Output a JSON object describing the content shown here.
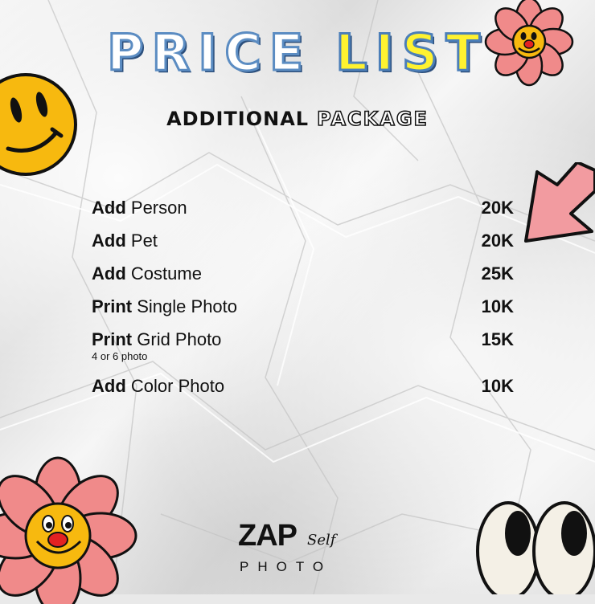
{
  "title": {
    "word1": "PRICE",
    "word2": "LIST"
  },
  "subtitle": {
    "part1": "ADDITIONAL",
    "part2": "PACKAGE"
  },
  "items": [
    {
      "bold": "Add",
      "rest": "Person",
      "price": "20K"
    },
    {
      "bold": "Add",
      "rest": "Pet",
      "price": "20K"
    },
    {
      "bold": "Add",
      "rest": "Costume",
      "price": "25K"
    },
    {
      "bold": "Print",
      "rest": "Single Photo",
      "price": "10K"
    },
    {
      "bold": "Print",
      "rest": "Grid Photo",
      "price": "15K",
      "note": "4 or 6 photo"
    },
    {
      "bold": "Add",
      "rest": "Color Photo",
      "price": "10K"
    }
  ],
  "logo": {
    "main": "ZAP",
    "script": "Self",
    "sub": "PHOTO"
  },
  "colors": {
    "title_white": "#ffffff",
    "title_yellow": "#fff230",
    "title_outline": "#5b8cc2",
    "smiley": "#f7b90f",
    "flower": "#f08a8a",
    "arrow": "#f29ba0"
  },
  "icons": [
    "smiley-face-icon",
    "flower-face-icon",
    "arrow-icon",
    "cartoon-eyes-icon"
  ]
}
